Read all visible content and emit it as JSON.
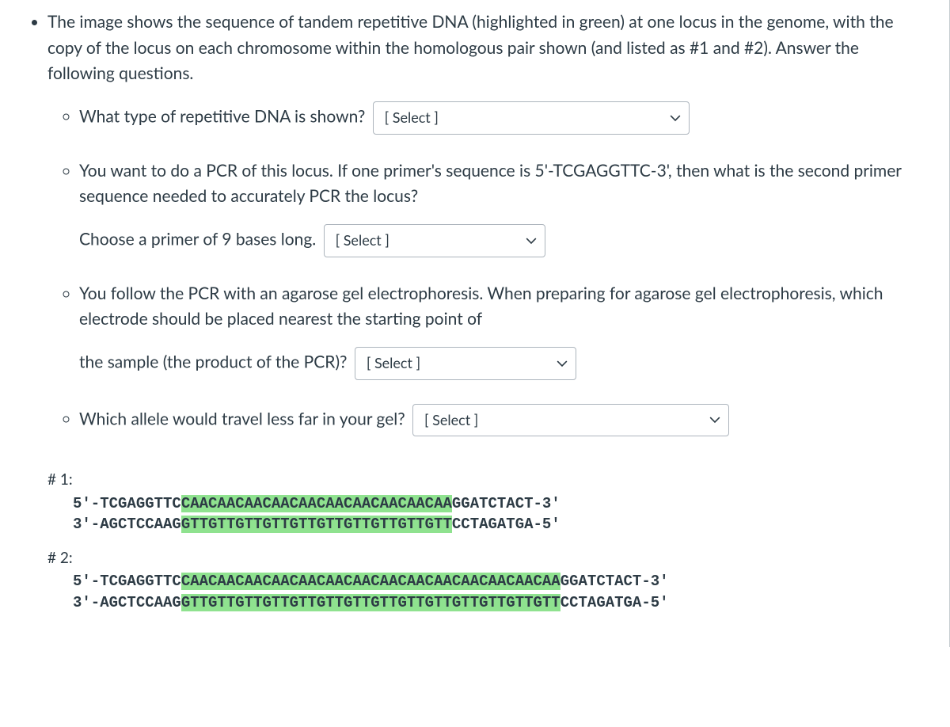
{
  "intro": "The image shows the sequence of tandem repetitive DNA (highlighted in green) at one locus in the genome, with the copy of the locus on each chromosome within the homologous pair shown (and listed as #1 and #2). Answer the following questions.",
  "q1": {
    "text": "What type of repetitive DNA is shown?",
    "select": "[ Select ]"
  },
  "q2": {
    "line1": "You want to do a PCR of this locus.  If one primer's sequence is 5'-TCGAGGTTC-3', then what is the second primer sequence needed to accurately PCR the locus?",
    "line2": "Choose a primer of 9 bases long.",
    "select": "[ Select ]"
  },
  "q3": {
    "text": "You follow the PCR with an agarose gel electrophoresis.  When preparing for agarose gel electrophoresis, which electrode should be placed nearest the starting point of the sample (the product of the PCR)?",
    "select": "[ Select ]"
  },
  "q4": {
    "text": "Which allele would travel less far in your gel?",
    "select": "[ Select ]"
  },
  "seq": {
    "label1": "# 1:",
    "a1_top_pre": "5'-TCGAGGTTC",
    "a1_top_hl": "CAACAACAACAACAACAACAACAACAACAA",
    "a1_top_post": "GGATCTACT-3'",
    "a1_bot_pre": "3'-AGCTCCAAG",
    "a1_bot_hl": "GTTGTTGTTGTTGTTGTTGTTGTTGTTGTT",
    "a1_bot_post": "CCTAGATGA-5'",
    "label2": "# 2:",
    "a2_top_pre": "5'-TCGAGGTTC",
    "a2_top_hl": "CAACAACAACAACAACAACAACAACAACAACAACAACAACAA",
    "a2_top_post": "GGATCTACT-3'",
    "a2_bot_pre": "3'-AGCTCCAAG",
    "a2_bot_hl": "GTTGTTGTTGTTGTTGTTGTTGTTGTTGTTGTTGTTGTTGTT",
    "a2_bot_post": "CCTAGATGA-5'"
  }
}
